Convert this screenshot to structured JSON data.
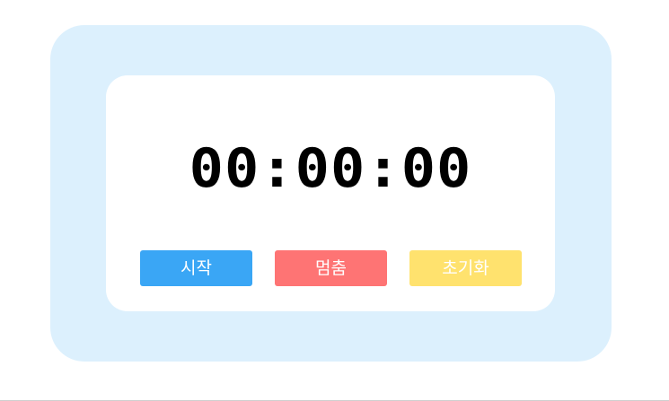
{
  "stopwatch": {
    "time_display": "00:00:00",
    "buttons": {
      "start": {
        "label": "시작",
        "color": "#3aa6f5"
      },
      "stop": {
        "label": "멈춤",
        "color": "#fe7474"
      },
      "reset": {
        "label": "초기화",
        "color": "#ffe26e"
      }
    }
  },
  "colors": {
    "outer_panel": "#dcf0fd",
    "inner_panel": "#ffffff",
    "timer_text": "#000000"
  }
}
